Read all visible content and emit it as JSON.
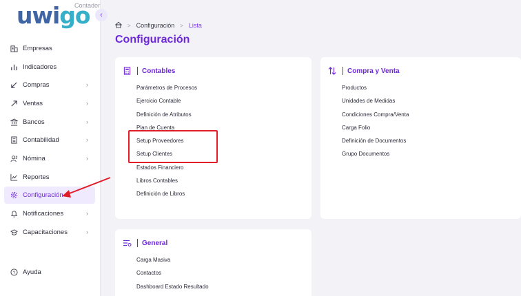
{
  "logo": {
    "brand": "uwigo",
    "sub": "Contador"
  },
  "sidebar": {
    "items": [
      {
        "label": "Empresas",
        "icon": "building-icon",
        "has_chevron": false
      },
      {
        "label": "Indicadores",
        "icon": "bar-chart-icon",
        "has_chevron": false
      },
      {
        "label": "Compras",
        "icon": "arrow-down-left-icon",
        "has_chevron": true
      },
      {
        "label": "Ventas",
        "icon": "arrow-up-right-icon",
        "has_chevron": true
      },
      {
        "label": "Bancos",
        "icon": "bank-icon",
        "has_chevron": true
      },
      {
        "label": "Contabilidad",
        "icon": "calculator-icon",
        "has_chevron": true
      },
      {
        "label": "Nómina",
        "icon": "users-icon",
        "has_chevron": true
      },
      {
        "label": "Reportes",
        "icon": "line-chart-icon",
        "has_chevron": false
      },
      {
        "label": "Configuración",
        "icon": "gear-icon",
        "has_chevron": false,
        "active": true
      },
      {
        "label": "Notificaciones",
        "icon": "bell-icon",
        "has_chevron": true
      },
      {
        "label": "Capacitaciones",
        "icon": "graduation-cap-icon",
        "has_chevron": true
      }
    ],
    "help": {
      "label": "Ayuda",
      "icon": "help-circle-icon"
    }
  },
  "breadcrumb": {
    "level1": "Configuración",
    "level2": "Lista"
  },
  "page_title": "Configuración",
  "cards": {
    "contables": {
      "title": "Contables",
      "items": [
        "Parámetros de Procesos",
        "Ejercicio Contable",
        "Definición de Atributos",
        "Plan de Cuenta",
        "Setup Proveedores",
        "Setup Clientes",
        "Estados Financiero",
        "Libros Contables",
        "Definición de Libros"
      ]
    },
    "compra_venta": {
      "title": "Compra y Venta",
      "items": [
        "Productos",
        "Unidades de Medidas",
        "Condiciones Compra/Venta",
        "Carga Folio",
        "Definición de Documentos",
        "Grupo Documentos"
      ]
    },
    "general": {
      "title": "General",
      "items": [
        "Carga Masiva",
        "Contactos",
        "Dashboard Estado Resultado"
      ]
    }
  },
  "colors": {
    "accent": "#6d28d9",
    "highlight": "#e11d2a",
    "logo_blue": "#3f65a5",
    "logo_teal": "#36b0c8"
  }
}
